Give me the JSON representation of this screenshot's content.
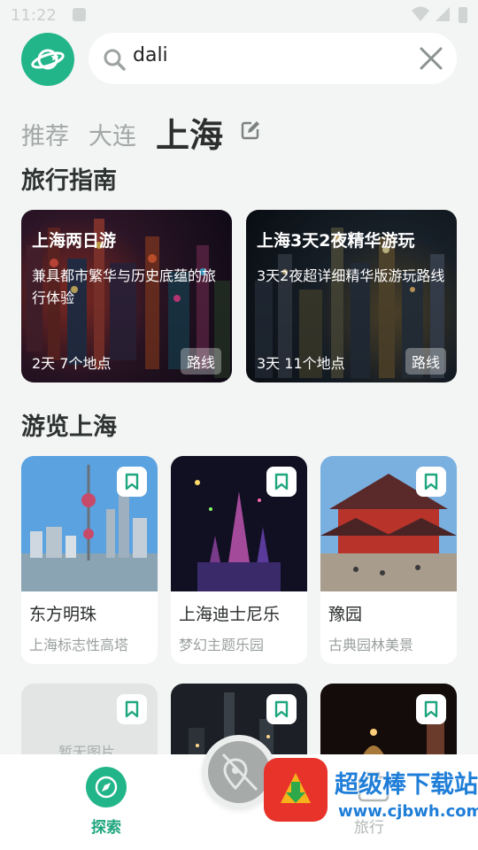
{
  "status_bar": {
    "time": "11:22"
  },
  "search": {
    "query": "dali",
    "placeholder": ""
  },
  "city_tabs": [
    {
      "label": "推荐"
    },
    {
      "label": "大连"
    },
    {
      "label": "上海",
      "active": true
    }
  ],
  "sections": {
    "guide_title": "旅行指南",
    "tour_title": "游览上海"
  },
  "guides": [
    {
      "title": "上海两日游",
      "desc": "兼具都市繁华与历史底蕴的旅行体验",
      "meta": "2天 7个地点",
      "badge": "路线"
    },
    {
      "title": "上海3天2夜精华游玩",
      "desc": "3天2夜超详细精华版游玩路线",
      "meta": "3天 11个地点",
      "badge": "路线"
    }
  ],
  "pois": [
    {
      "name": "东方明珠",
      "sub": "上海标志性高塔"
    },
    {
      "name": "上海迪士尼乐",
      "sub": "梦幻主题乐园"
    },
    {
      "name": "豫园",
      "sub": "古典园林美景"
    }
  ],
  "pois_row2": [
    {
      "placeholder": "暂无图片"
    },
    {},
    {}
  ],
  "bottom_nav": {
    "explore_label": "探索",
    "trip_label": "旅行"
  },
  "watermark": {
    "text": "超级棒下载站",
    "url": "www.cjbwh.com"
  },
  "colors": {
    "accent": "#23b58a",
    "background": "#f3f5f4"
  },
  "icons": [
    "planet-logo-icon",
    "search-icon",
    "clear-icon",
    "edit-icon",
    "bookmark-icon",
    "compass-icon",
    "map-pin-icon",
    "suitcase-icon"
  ]
}
